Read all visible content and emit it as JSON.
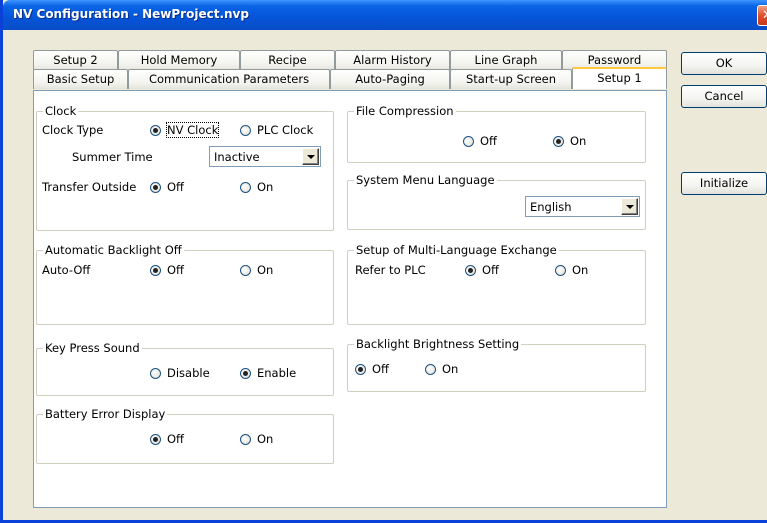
{
  "window": {
    "title": "NV Configuration - NewProject.nvp",
    "close_glyph": "✕"
  },
  "tabs_row1": [
    "Setup 2",
    "Hold Memory",
    "Recipe",
    "Alarm History",
    "Line Graph",
    "Password"
  ],
  "tabs_row2": [
    "Basic Setup",
    "Communication Parameters",
    "Auto-Paging",
    "Start-up Screen",
    "Setup 1"
  ],
  "active_tab": "Setup 1",
  "clock": {
    "legend": "Clock",
    "clock_type_label": "Clock Type",
    "nv_clock": "NV Clock",
    "plc_clock": "PLC Clock",
    "summer_time_label": "Summer Time",
    "summer_time_value": "Inactive",
    "transfer_outside_label": "Transfer Outside",
    "off": "Off",
    "on": "On"
  },
  "backlight_off": {
    "legend": "Automatic Backlight Off",
    "label": "Auto-Off",
    "off": "Off",
    "on": "On"
  },
  "key_sound": {
    "legend": "Key Press Sound",
    "disable": "Disable",
    "enable": "Enable"
  },
  "battery": {
    "legend": "Battery Error Display",
    "off": "Off",
    "on": "On"
  },
  "compression": {
    "legend": "File Compression",
    "off": "Off",
    "on": "On"
  },
  "language": {
    "legend": "System Menu Language",
    "value": "English"
  },
  "multilang": {
    "legend": "Setup of Multi-Language Exchange",
    "label": "Refer to PLC",
    "off": "Off",
    "on": "On"
  },
  "brightness": {
    "legend": "Backlight Brightness Setting",
    "off": "Off",
    "on": "On"
  },
  "buttons": {
    "ok": "OK",
    "cancel": "Cancel",
    "initialize": "Initialize"
  }
}
